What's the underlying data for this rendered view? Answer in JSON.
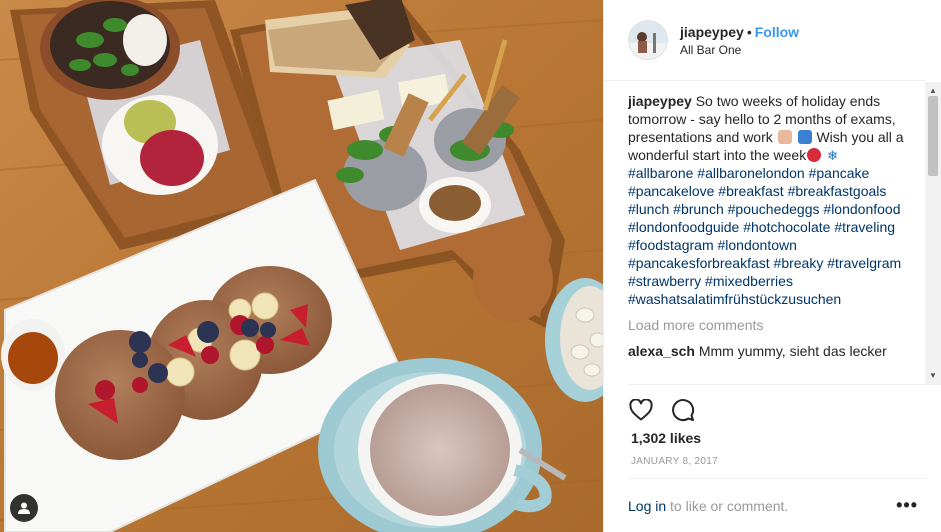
{
  "header": {
    "username": "jiapeypey",
    "separator": "•",
    "follow_label": "Follow",
    "location": "All Bar One"
  },
  "caption": {
    "username": "jiapeypey",
    "text_part1": "So two weeks of holiday ends tomorrow - say hello to 2 months of exams, presentations and work",
    "text_part2": "Wish you all a wonderful start into the week",
    "hashtags": [
      "#allbarone",
      "#allbaronelondon",
      "#pancake",
      "#pancakelove",
      "#breakfast",
      "#breakfastgoals",
      "#lunch",
      "#brunch",
      "#pouchedeggs",
      "#londonfood",
      "#londonfoodguide",
      "#hotchocolate",
      "#traveling",
      "#foodstagram",
      "#londontown",
      "#pancakesforbreakfast",
      "#breaky",
      "#travelgram",
      "#strawberry",
      "#mixedberries",
      "#washatsalatimfrühstückzusuchen"
    ]
  },
  "load_more_label": "Load more comments",
  "comments": [
    {
      "username": "alexa_sch",
      "text": "Mmm yummy, sieht das lecker"
    }
  ],
  "likes": "1,302 likes",
  "date": "JANUARY 8, 2017",
  "footer": {
    "login_label": "Log in",
    "suffix": "to like or comment.",
    "more_label": "•••"
  },
  "icons": {
    "heart": "heart-outline-icon",
    "comment": "comment-bubble-icon",
    "user_tag": "user-tag-icon",
    "more": "more-options-icon"
  },
  "colors": {
    "link_blue": "#3897f0",
    "hashtag_navy": "#003569",
    "muted_gray": "#999999"
  }
}
